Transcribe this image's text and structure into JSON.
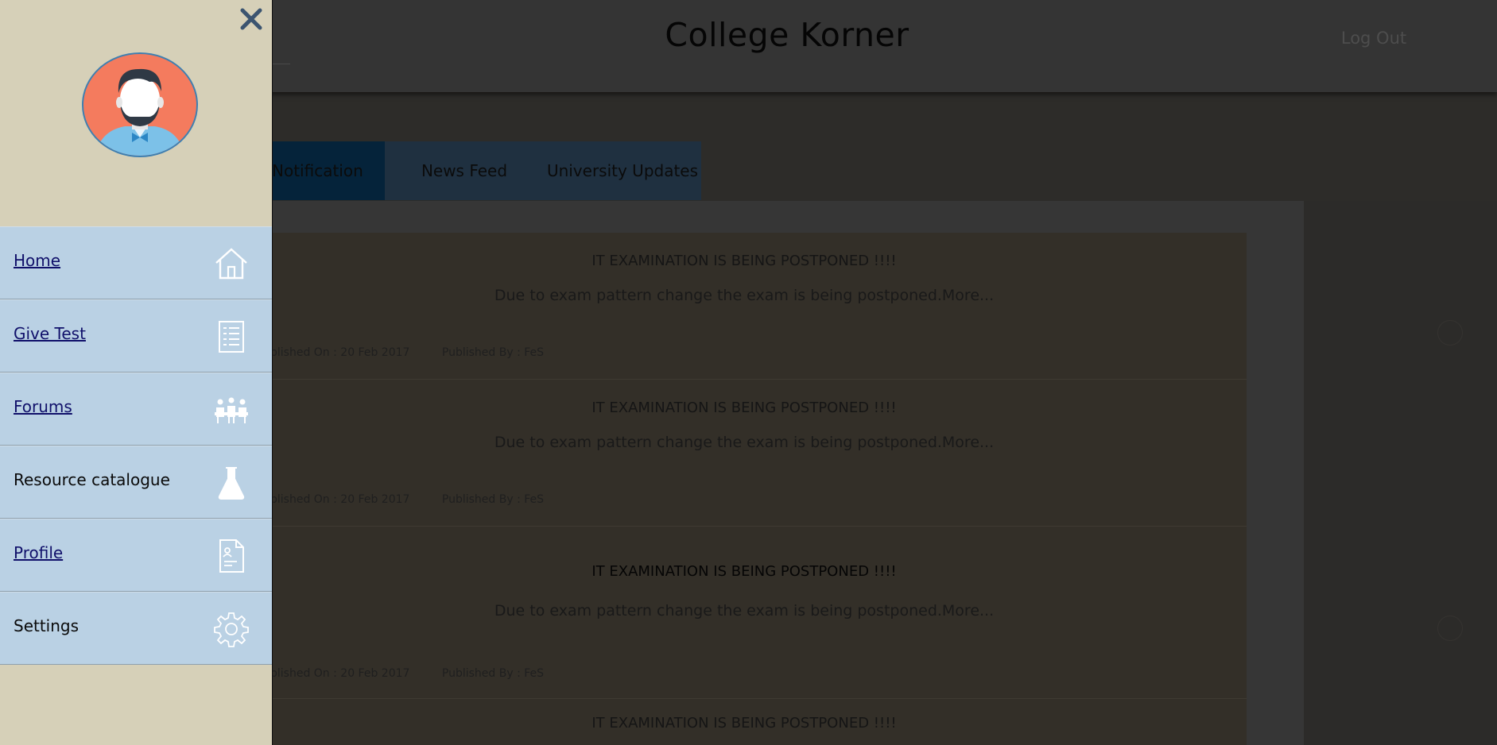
{
  "header": {
    "title": "College Korner",
    "logout_label": "Log Out"
  },
  "tabs": [
    {
      "label": "Notification"
    },
    {
      "label": "News Feed"
    },
    {
      "label": "University Updates"
    }
  ],
  "feed": {
    "items": [
      {
        "title": "IT EXAMINATION IS BEING POSTPONED !!!!",
        "description": "Due to exam pattern change the exam is being postponed.More...",
        "published_on": "blished On : 20 Feb 2017",
        "published_by": "Published By : FeS"
      },
      {
        "title": "IT EXAMINATION IS BEING POSTPONED !!!!",
        "description": "Due to exam pattern change the exam is being postponed.More...",
        "published_on": "blished On : 20 Feb 2017",
        "published_by": "Published By : FeS"
      },
      {
        "title": "IT EXAMINATION IS BEING POSTPONED !!!!",
        "description": "Due to exam pattern change the exam is being postponed.More...",
        "published_on": "blished On : 20 Feb 2017",
        "published_by": "Published By : FeS"
      },
      {
        "title": "IT EXAMINATION IS BEING POSTPONED !!!!"
      }
    ]
  },
  "drawer": {
    "close_icon": "close-icon",
    "avatar_icon": "user-avatar",
    "menu": [
      {
        "label": "Home",
        "icon": "home-icon",
        "linked": true
      },
      {
        "label": "Give Test",
        "icon": "test-sheet-icon",
        "linked": true
      },
      {
        "label": "Forums",
        "icon": "forum-group-icon",
        "linked": true
      },
      {
        "label": "Resource catalogue",
        "icon": "flask-icon",
        "linked": false
      },
      {
        "label": "Profile",
        "icon": "profile-document-icon",
        "linked": true
      },
      {
        "label": "Settings",
        "icon": "gear-icon",
        "linked": false
      }
    ]
  },
  "colors": {
    "drawer_bg": "#d6d0b8",
    "menu_bg": "#bad1e4",
    "active_tab": "#05233a",
    "avatar_bg": "#f47b5e",
    "avatar_ring": "#3f7fb0"
  }
}
